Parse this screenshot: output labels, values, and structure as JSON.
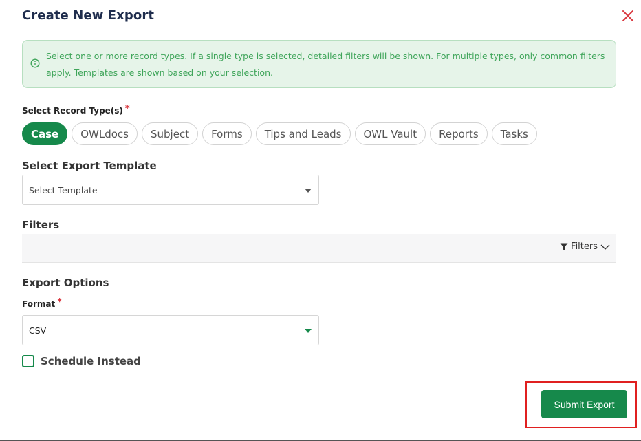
{
  "dialog": {
    "title": "Create New Export",
    "close_icon": "close-x-icon"
  },
  "alert": {
    "icon": "info-icon",
    "message": "Select one or more record types. If a single type is selected, detailed filters will be shown. For multiple types, only common filters apply. Templates are shown based on your selection."
  },
  "record_types": {
    "label": "Select Record Type(s)",
    "required_mark": "*",
    "items": [
      {
        "label": "Case",
        "selected": true
      },
      {
        "label": "OWLdocs",
        "selected": false
      },
      {
        "label": "Subject",
        "selected": false
      },
      {
        "label": "Forms",
        "selected": false
      },
      {
        "label": "Tips and Leads",
        "selected": false
      },
      {
        "label": "OWL Vault",
        "selected": false
      },
      {
        "label": "Reports",
        "selected": false
      },
      {
        "label": "Tasks",
        "selected": false
      }
    ]
  },
  "template": {
    "label": "Select Export Template",
    "placeholder": "Select Template"
  },
  "filters": {
    "label": "Filters",
    "toggle_label": "Filters",
    "icons": [
      "filter-funnel-icon",
      "chevron-down-icon"
    ]
  },
  "export_options": {
    "label": "Export Options",
    "format_label": "Format",
    "required_mark": "*",
    "format_value": "CSV"
  },
  "schedule": {
    "label": "Schedule Instead",
    "checked": false
  },
  "actions": {
    "submit_label": "Submit Export"
  },
  "colors": {
    "primary": "#16894b",
    "alert_bg": "#e6f4e9",
    "alert_text": "#3fa55a",
    "required": "#d9363e",
    "highlight": "#e02020",
    "title": "#1f2d4d"
  }
}
